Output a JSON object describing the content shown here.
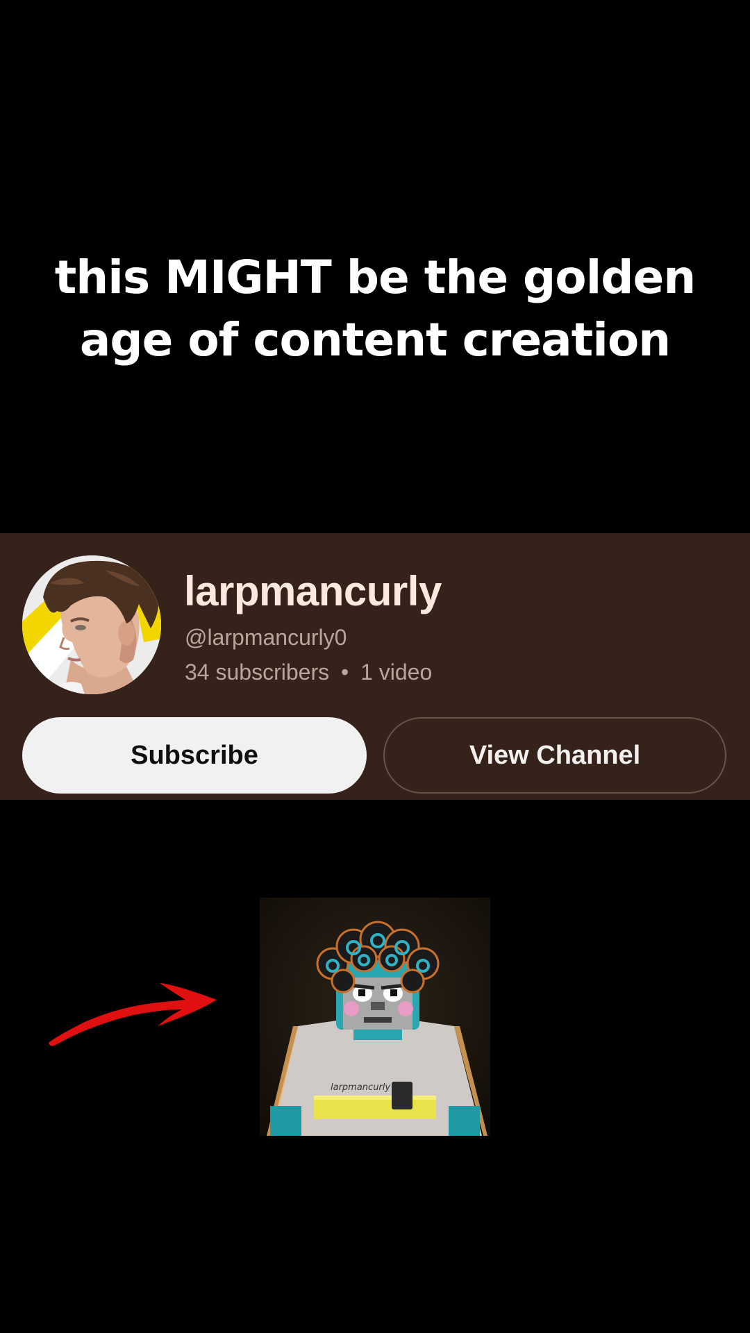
{
  "caption": {
    "line1": "this MIGHT be the golden",
    "line2": "age of content creation"
  },
  "channel": {
    "name": "larpmancurly",
    "handle": "@larpmancurly0",
    "subscribers": "34 subscribers",
    "separator": "•",
    "videos": "1 video",
    "subscribe_label": "Subscribe",
    "view_channel_label": "View Channel"
  },
  "thumbnail": {
    "shirt_text": "larpmancurly"
  },
  "colors": {
    "background": "#000000",
    "card": "#35221a",
    "name": "#fbe9df",
    "meta": "#b9a69c",
    "subscribe_bg": "#f1f1f1",
    "arrow": "#e01010"
  }
}
